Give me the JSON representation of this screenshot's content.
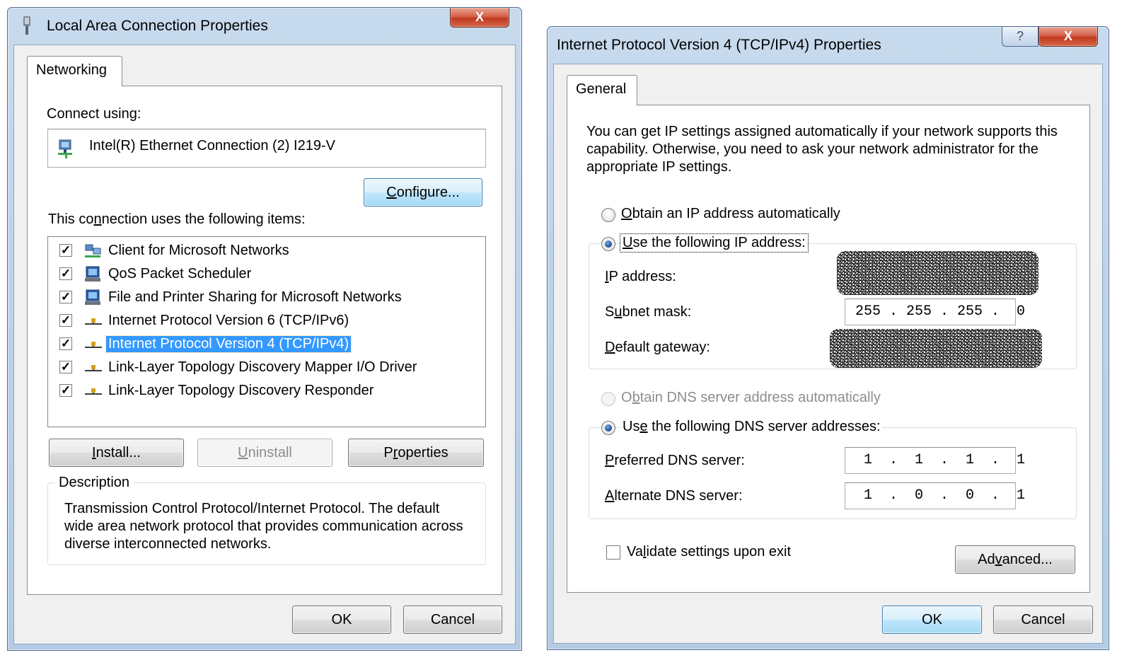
{
  "lan_dialog": {
    "title": "Local Area Connection Properties",
    "close_glyph": "X",
    "tab_label": "Networking",
    "connect_using_label": "Connect using:",
    "adapter_name": "Intel(R) Ethernet Connection (2) I219-V",
    "configure_label": "Configure...",
    "items_label": "This connection uses the following items:",
    "items": [
      {
        "label": "Client for Microsoft Networks",
        "checked": true,
        "icon": "network-client-icon"
      },
      {
        "label": "QoS Packet Scheduler",
        "checked": true,
        "icon": "network-service-icon"
      },
      {
        "label": "File and Printer Sharing for Microsoft Networks",
        "checked": true,
        "icon": "network-service-icon"
      },
      {
        "label": "Internet Protocol Version 6 (TCP/IPv6)",
        "checked": true,
        "icon": "protocol-icon"
      },
      {
        "label": "Internet Protocol Version 4 (TCP/IPv4)",
        "checked": true,
        "icon": "protocol-icon",
        "selected": true
      },
      {
        "label": "Link-Layer Topology Discovery Mapper I/O Driver",
        "checked": true,
        "icon": "protocol-icon"
      },
      {
        "label": "Link-Layer Topology Discovery Responder",
        "checked": true,
        "icon": "protocol-icon"
      }
    ],
    "install_label": "Install...",
    "uninstall_label": "Uninstall",
    "properties_label": "Properties",
    "description_title": "Description",
    "description_text": "Transmission Control Protocol/Internet Protocol. The default wide area network protocol that provides communication across diverse interconnected networks.",
    "ok_label": "OK",
    "cancel_label": "Cancel"
  },
  "ipv4_dialog": {
    "title": "Internet Protocol Version 4 (TCP/IPv4) Properties",
    "help_glyph": "?",
    "close_glyph": "X",
    "tab_label": "General",
    "intro_text": "You can get IP settings assigned automatically if your network supports this capability. Otherwise, you need to ask your network administrator for the appropriate IP settings.",
    "obtain_ip_auto_label": "Obtain an IP address automatically",
    "use_following_ip_label": "Use the following IP address:",
    "ip_address_label": "IP address:",
    "subnet_mask_label": "Subnet mask:",
    "subnet_mask_value": "255 . 255 . 255 .  0",
    "default_gateway_label": "Default gateway:",
    "obtain_dns_auto_label": "Obtain DNS server address automatically",
    "use_following_dns_label": "Use the following DNS server addresses:",
    "preferred_dns_label": "Preferred DNS server:",
    "preferred_dns_value": " 1  .  1  .  1  .  1",
    "alternate_dns_label": "Alternate DNS server:",
    "alternate_dns_value": " 1  .  0  .  0  .  1",
    "validate_label": "Validate settings upon exit",
    "advanced_label": "Advanced...",
    "ok_label": "OK",
    "cancel_label": "Cancel"
  },
  "colors": {
    "selection_blue": "#3399ff",
    "close_red": "#c0391f",
    "frame_blue": "#bcd2ea"
  }
}
